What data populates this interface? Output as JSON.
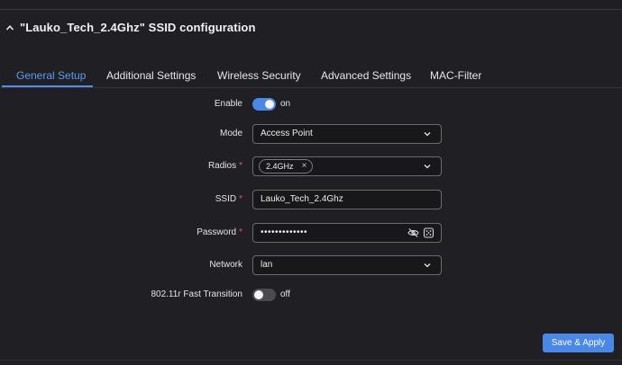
{
  "section": {
    "title": "\"Lauko_Tech_2.4Ghz\" SSID configuration"
  },
  "tabs": [
    {
      "label": "General Setup",
      "active": true
    },
    {
      "label": "Additional Settings",
      "active": false
    },
    {
      "label": "Wireless Security",
      "active": false
    },
    {
      "label": "Advanced Settings",
      "active": false
    },
    {
      "label": "MAC-Filter",
      "active": false
    }
  ],
  "form": {
    "enable": {
      "label": "Enable",
      "state": "on",
      "checked": true
    },
    "mode": {
      "label": "Mode",
      "value": "Access Point"
    },
    "radios": {
      "label": "Radios",
      "required_mark": "*",
      "chip": "2.4GHz",
      "chip_remove": "×"
    },
    "ssid": {
      "label": "SSID",
      "required_mark": "*",
      "value": "Lauko_Tech_2.4Ghz"
    },
    "password": {
      "label": "Password",
      "required_mark": "*",
      "value": "•••••••••••••"
    },
    "network": {
      "label": "Network",
      "value": "lan"
    },
    "fast_transition": {
      "label": "802.11r Fast Transition",
      "state": "off",
      "checked": false
    }
  },
  "actions": {
    "save_apply": "Save & Apply"
  },
  "colors": {
    "accent": "#4a88e8",
    "active_tab": "#5d9bf2",
    "required": "#ef5350",
    "background": "#202024"
  },
  "icons": {
    "collapse": "chevron-up-icon",
    "select_caret": "chevron-down-icon",
    "password_visibility": "eye-off-icon",
    "password_generate": "dice-icon"
  }
}
